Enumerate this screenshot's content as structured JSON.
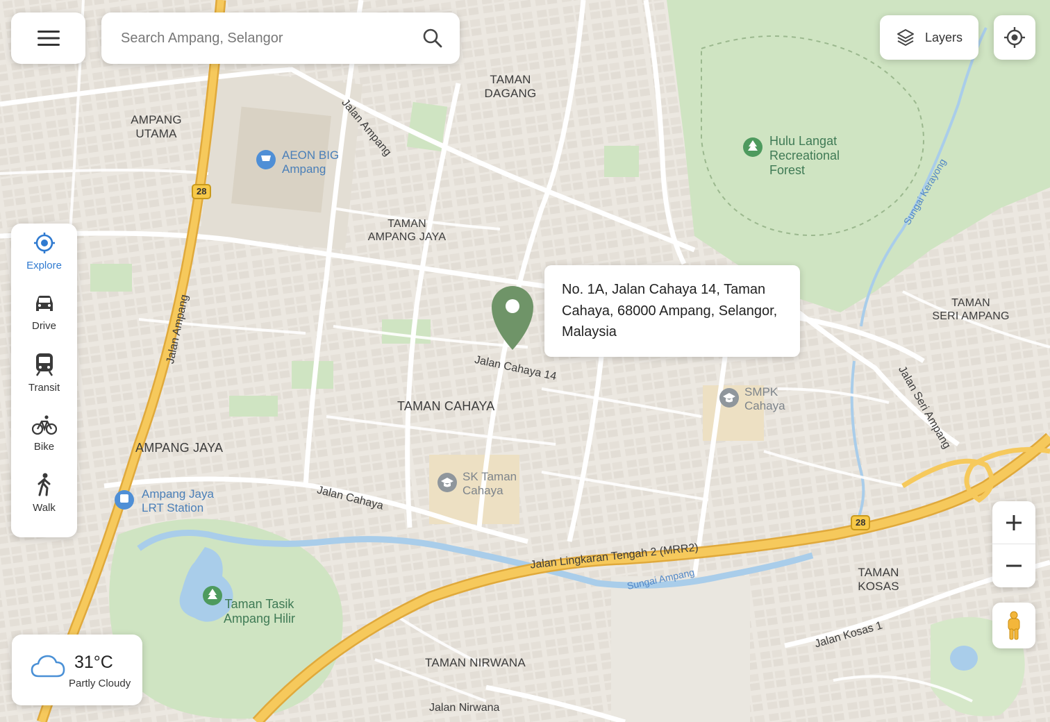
{
  "search": {
    "placeholder": "Search Ampang, Selangor"
  },
  "toolbar": {
    "layers_label": "Layers"
  },
  "modes": [
    {
      "label": "Explore",
      "icon": "explore-icon",
      "active": true
    },
    {
      "label": "Drive",
      "icon": "car-icon",
      "active": false
    },
    {
      "label": "Transit",
      "icon": "train-icon",
      "active": false
    },
    {
      "label": "Bike",
      "icon": "bicycle-icon",
      "active": false
    },
    {
      "label": "Walk",
      "icon": "walk-icon",
      "active": false
    }
  ],
  "selected_place": {
    "address": "No. 1A, Jalan Cahaya 14, Taman Cahaya, 68000 Ampang, Selangor, Malaysia"
  },
  "weather": {
    "temperature": "31°C",
    "condition": "Partly Cloudy"
  },
  "map": {
    "areas": {
      "taman_dagang": "TAMAN\nDAGANG",
      "ampang_utama": "AMPANG\nUTAMA",
      "taman_ampang_jaya": "TAMAN\nAMPANG JAYA",
      "taman_seri_ampang": "TAMAN\nSERI AMPANG",
      "taman_cahaya": "TAMAN CAHAYA",
      "ampang_jaya": "AMPANG JAYA",
      "taman_kosas": "TAMAN\nKOSAS",
      "taman_nirwana": "TAMAN NIRWANA"
    },
    "pois": {
      "aeon_big": "AEON BIG\nAmpang",
      "hulu_langat_forest": "Hulu Langat\nRecreational\nForest",
      "smpk_cahaya": "SMPK\nCahaya",
      "sk_taman_cahaya": "SK Taman\nCahaya",
      "ampang_jaya_lrt": "Ampang Jaya\nLRT Station",
      "taman_tasik": "Taman Tasik\nAmpang Hilir"
    },
    "roads": {
      "jalan_ampang_north": "Jalan Ampang",
      "jalan_ampang_west": "Jalan Ampang",
      "jalan_cahaya_14": "Jalan Cahaya 14",
      "jalan_cahaya": "Jalan Cahaya",
      "jalan_seri_ampang": "Jalan Seri Ampang",
      "mrr2": "Jalan Lingkaran Tengah 2 (MRR2)",
      "jalan_kosas_1": "Jalan Kosas 1",
      "jalan_nirwana": "Jalan Nirwana"
    },
    "waterways": {
      "sungai_ampang": "Sungai Ampang",
      "sungai_kerayong": "Sungai Kerayong"
    },
    "route_shields": {
      "north": "28",
      "east": "28"
    }
  }
}
